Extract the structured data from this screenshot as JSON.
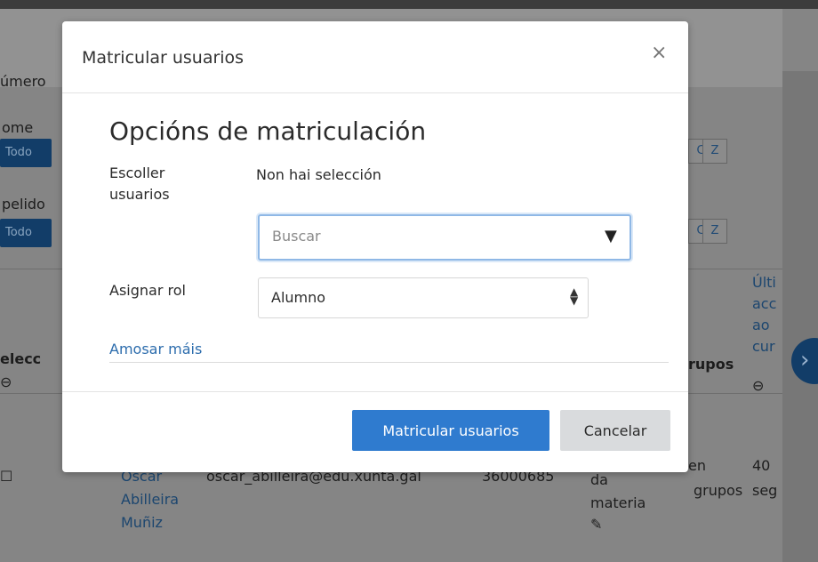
{
  "background": {
    "labels": {
      "numero": "úmero",
      "nome": "ome",
      "apelido": "pelido",
      "todo_1": "Todo",
      "todo_2": "Todo",
      "letter_c1": "C",
      "letter_z1": "Z",
      "letter_c2": "C",
      "letter_z2": "Z",
      "select_col": "elecc",
      "groups_col": "rupos",
      "last_access": [
        "Últi",
        "acc",
        "ao",
        "cur"
      ]
    },
    "row": {
      "name_lines": [
        "Oscar",
        "Abilleira",
        "Muñiz"
      ],
      "email": "oscar_abilleira@edu.xunta.gal",
      "id": "36000685",
      "role_lines": [
        "da",
        "materia"
      ],
      "groups_lines": [
        "en",
        "grupos"
      ],
      "time_lines": [
        "40",
        "seg"
      ]
    }
  },
  "modal": {
    "title": "Matricular usuarios",
    "close_symbol": "×",
    "section_title": "Opcións de matriculación",
    "select_users_label": "Escoller usuarios",
    "no_selection": "Non hai selección",
    "search_placeholder": "Buscar",
    "dropdown_icon": "▼",
    "assign_role_label": "Asignar rol",
    "role_value": "Alumno",
    "show_more": "Amosar máis",
    "enrol_button": "Matricular usuarios",
    "cancel_button": "Cancelar"
  },
  "colors": {
    "primary": "#2f7bcf",
    "link": "#2d6dad",
    "cancel_bg": "#d9dbdd"
  }
}
